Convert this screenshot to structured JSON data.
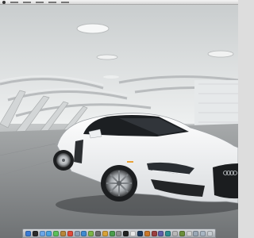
{
  "menubar": {
    "items": [
      "",
      "",
      "",
      "",
      ""
    ]
  },
  "desktop": {
    "wallpaper": "white-sports-car-in-white-architectural-hall"
  },
  "dock": {
    "apps": [
      {
        "name": "finder-icon",
        "color": "#3a7bd5"
      },
      {
        "name": "dashboard-icon",
        "color": "#2b2b2b"
      },
      {
        "name": "mail-icon",
        "color": "#6aa6e8"
      },
      {
        "name": "safari-icon",
        "color": "#4aa3e0"
      },
      {
        "name": "ichat-icon",
        "color": "#5bc05b"
      },
      {
        "name": "address-book-icon",
        "color": "#b8863b"
      },
      {
        "name": "ical-icon",
        "color": "#e04b3c"
      },
      {
        "name": "preview-icon",
        "color": "#8a9fb5"
      },
      {
        "name": "itunes-icon",
        "color": "#3f8bd1"
      },
      {
        "name": "iphoto-icon",
        "color": "#7cb548"
      },
      {
        "name": "imovie-icon",
        "color": "#6d6d6d"
      },
      {
        "name": "garageband-icon",
        "color": "#d8a33a"
      },
      {
        "name": "time-machine-icon",
        "color": "#4b9c4b"
      },
      {
        "name": "system-preferences-icon",
        "color": "#8f8f8f"
      },
      {
        "name": "terminal-icon",
        "color": "#222222"
      },
      {
        "name": "textedit-icon",
        "color": "#e8e8e8"
      },
      {
        "name": "photoshop-icon",
        "color": "#1d3b5e"
      },
      {
        "name": "illustrator-icon",
        "color": "#c9772a"
      },
      {
        "name": "app-icon",
        "color": "#9c3f3f"
      },
      {
        "name": "app-icon",
        "color": "#5f5fa8"
      },
      {
        "name": "app-icon",
        "color": "#2e8f8f"
      },
      {
        "name": "app-icon",
        "color": "#b8b8b8"
      },
      {
        "name": "app-icon",
        "color": "#6b8e3a"
      },
      {
        "name": "app-icon",
        "color": "#d0d0d0"
      },
      {
        "name": "downloads-stack-icon",
        "color": "#9aa7b5"
      },
      {
        "name": "documents-stack-icon",
        "color": "#a8b5c2"
      },
      {
        "name": "trash-icon",
        "color": "#c7ccd1"
      }
    ]
  }
}
